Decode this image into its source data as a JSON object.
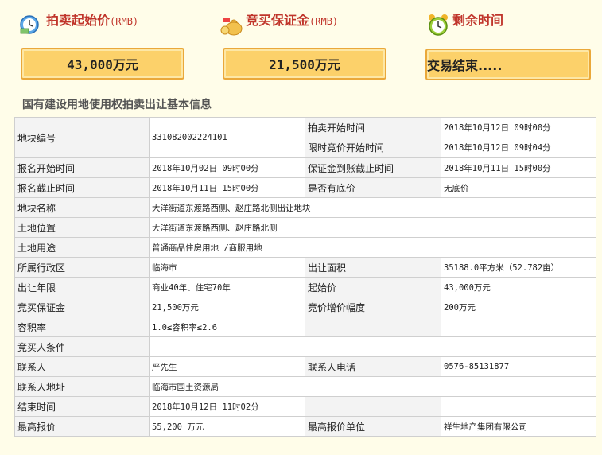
{
  "header": {
    "start_price": {
      "label": "拍卖起始价",
      "unit": "(RMB)",
      "value": "43,000万元"
    },
    "deposit": {
      "label": "竞买保证金",
      "unit": "(RMB)",
      "value": "21,500万元"
    },
    "time_left": {
      "label": "剩余时间",
      "value": "交易结束....."
    }
  },
  "section_title": "国有建设用地使用权拍卖出让基本信息",
  "table": {
    "parcel_no_label": "地块编号",
    "parcel_no": "331082002224101",
    "auction_start_label": "拍卖开始时间",
    "auction_start": "2018年10月12日 09时00分",
    "limited_bid_start_label": "限时竞价开始时间",
    "limited_bid_start": "2018年10月12日 09时04分",
    "reg_start_label": "报名开始时间",
    "reg_start": "2018年10月02日 09时00分",
    "deposit_deadline_label": "保证金到账截止时间",
    "deposit_deadline": "2018年10月11日 15时00分",
    "reg_end_label": "报名截止时间",
    "reg_end": "2018年10月11日 15时00分",
    "reserve_label": "是否有底价",
    "reserve": "无底价",
    "name_label": "地块名称",
    "name": "大洋街道东渡路西侧、赵庄路北侧出让地块",
    "location_label": "土地位置",
    "location": "大洋街道东渡路西侧、赵庄路北侧",
    "usage_label": "土地用途",
    "usage": "普通商品住房用地 /商服用地",
    "district_label": "所属行政区",
    "district": "临海市",
    "area_label": "出让面积",
    "area": "35188.0平方米（52.782亩）",
    "term_label": "出让年限",
    "term": "商业40年、住宅70年",
    "start_price_label": "起始价",
    "start_price": "43,000万元",
    "bid_deposit_label": "竞买保证金",
    "bid_deposit": "21,500万元",
    "increment_label": "竞价增价幅度",
    "increment": "200万元",
    "far_label": "容积率",
    "far": "1.0≤容积率≤2.6",
    "conditions_label": "竞买人条件",
    "contact_label": "联系人",
    "contact": "严先生",
    "phone_label": "联系人电话",
    "phone": "0576-85131877",
    "address_label": "联系人地址",
    "address": "临海市国土资源局",
    "end_time_label": "结束时间",
    "end_time": "2018年10月12日 11时02分",
    "top_bid_label": "最高报价",
    "top_bid": "55,200 万元",
    "top_bidder_label": "最高报价单位",
    "top_bidder": "祥生地产集团有限公司"
  },
  "colors": {
    "accent_red": "#c0352b",
    "box_fill": "#fcd16a",
    "box_border": "#eaa83a"
  },
  "icons": [
    "clock-money-icon",
    "money-bag-icon",
    "alarm-clock-icon"
  ]
}
